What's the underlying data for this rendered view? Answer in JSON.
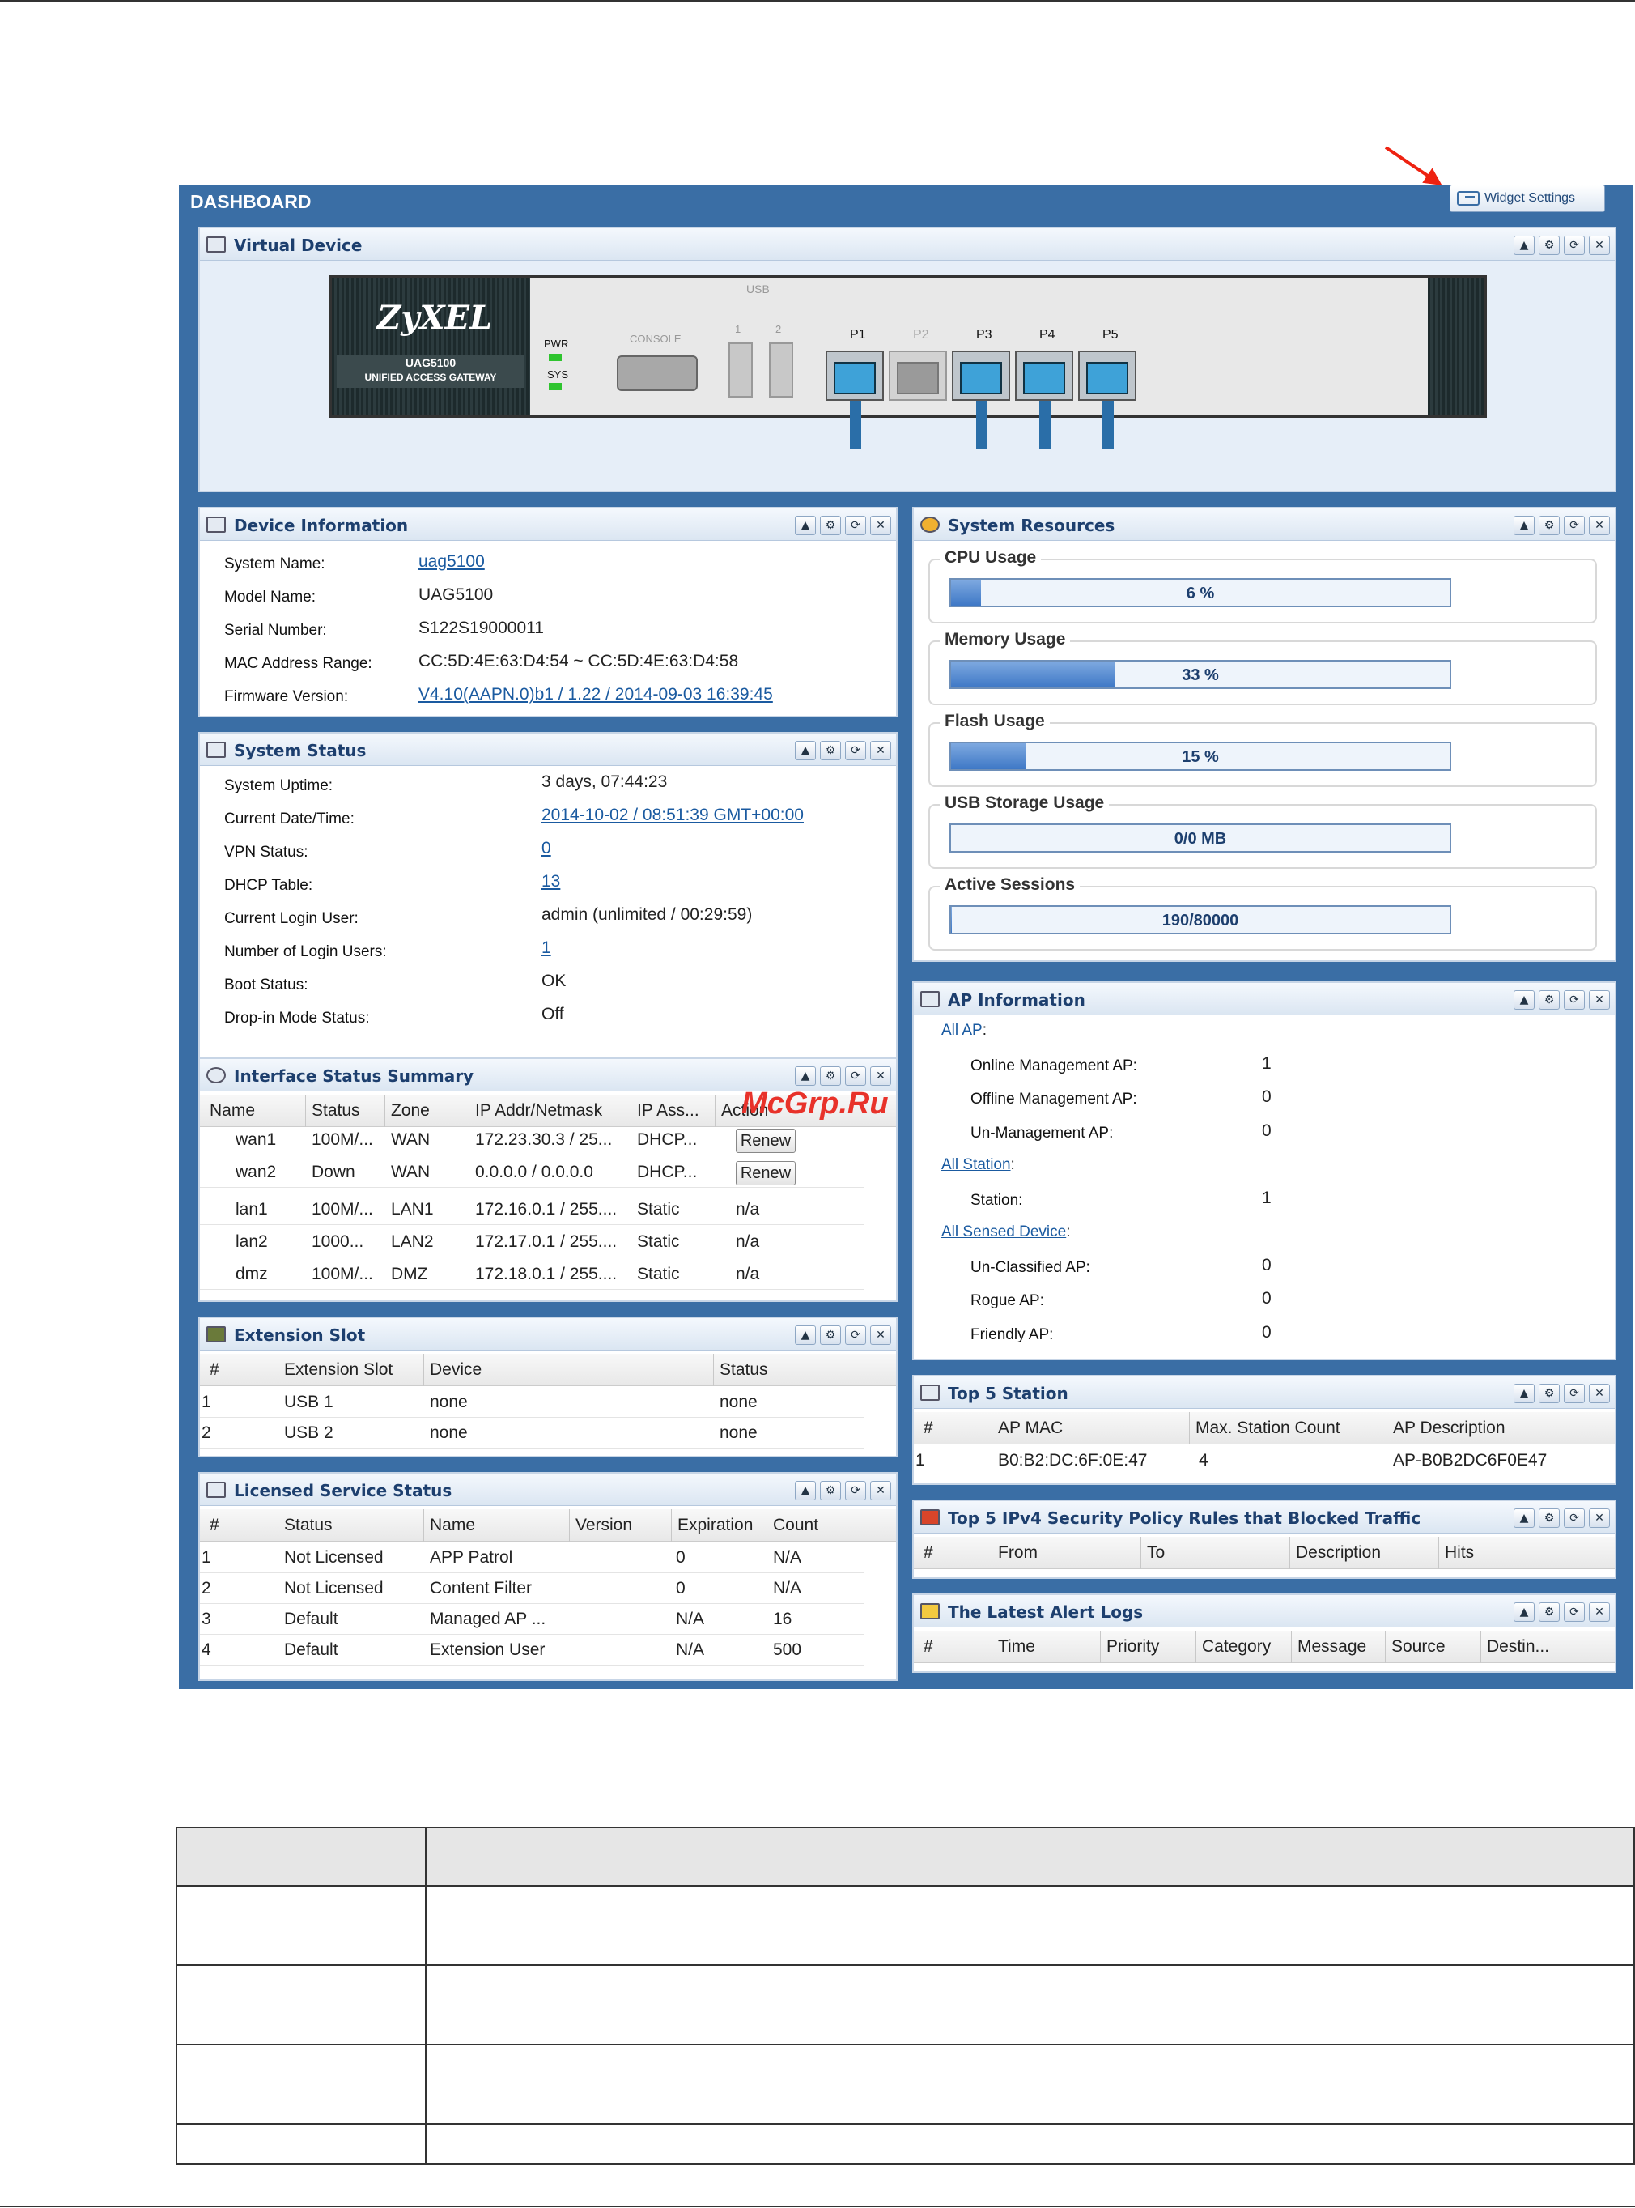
{
  "dashboard": {
    "title": "DASHBOARD",
    "widget_settings": "Widget Settings"
  },
  "virtual_device": {
    "title": "Virtual Device",
    "brand": "ZyXEL",
    "model": "UAG5100",
    "model_sub": "UNIFIED ACCESS GATEWAY",
    "leds": [
      "PWR",
      "SYS"
    ],
    "console": "CONSOLE",
    "usb": "USB",
    "usb_ports": [
      "1",
      "2"
    ],
    "ports": [
      "P1",
      "P2",
      "P3",
      "P4",
      "P5"
    ]
  },
  "device_info": {
    "title": "Device Information",
    "rows": [
      {
        "label": "System Name:",
        "value": "uag5100"
      },
      {
        "label": "Model Name:",
        "value": "UAG5100"
      },
      {
        "label": "Serial Number:",
        "value": "S122S19000011"
      },
      {
        "label": "MAC Address Range:",
        "value": "CC:5D:4E:63:D4:54 ~ CC:5D:4E:63:D4:58"
      },
      {
        "label": "Firmware Version:",
        "value": "V4.10(AAPN.0)b1 / 1.22 / 2014-09-03 16:39:45"
      }
    ]
  },
  "system_status": {
    "title": "System Status",
    "rows": [
      {
        "label": "System Uptime:",
        "value": "3 days, 07:44:23"
      },
      {
        "label": "Current Date/Time:",
        "value": "2014-10-02 / 08:51:39 GMT+00:00"
      },
      {
        "label": "VPN Status:",
        "value": "0"
      },
      {
        "label": "DHCP Table:",
        "value": "13"
      },
      {
        "label": "Current Login User:",
        "value": "admin (unlimited / 00:29:59)"
      },
      {
        "label": "Number of Login Users:",
        "value": "1"
      },
      {
        "label": "Boot Status:",
        "value": "OK"
      },
      {
        "label": "Drop-in Mode Status:",
        "value": "Off"
      }
    ]
  },
  "interface": {
    "title": "Interface Status Summary",
    "headers": [
      "Name",
      "Status",
      "Zone",
      "IP Addr/Netmask",
      "IP Ass...",
      "Action"
    ],
    "rows": [
      {
        "name": "wan1",
        "status": "100M/...",
        "zone": "WAN",
        "ip": "172.23.30.3 / 25...",
        "assign": "DHCP...",
        "action": "Renew"
      },
      {
        "name": "wan2",
        "status": "Down",
        "zone": "WAN",
        "ip": "0.0.0.0 / 0.0.0.0",
        "assign": "DHCP...",
        "action": "Renew"
      },
      {
        "name": "lan1",
        "status": "100M/...",
        "zone": "LAN1",
        "ip": "172.16.0.1 / 255....",
        "assign": "Static",
        "action": "n/a"
      },
      {
        "name": "lan2",
        "status": "1000...",
        "zone": "LAN2",
        "ip": "172.17.0.1 / 255....",
        "assign": "Static",
        "action": "n/a"
      },
      {
        "name": "dmz",
        "status": "100M/...",
        "zone": "DMZ",
        "ip": "172.18.0.1 / 255....",
        "assign": "Static",
        "action": "n/a"
      }
    ]
  },
  "extension_slot": {
    "title": "Extension Slot",
    "headers": [
      "#",
      "Extension Slot",
      "Device",
      "Status"
    ],
    "rows": [
      [
        "1",
        "USB 1",
        "none",
        "none"
      ],
      [
        "2",
        "USB 2",
        "none",
        "none"
      ]
    ]
  },
  "licensed": {
    "title": "Licensed Service Status",
    "headers": [
      "#",
      "Status",
      "Name",
      "Version",
      "Expiration",
      "Count"
    ],
    "rows": [
      [
        "1",
        "Not Licensed",
        "APP Patrol",
        "",
        "0",
        "N/A"
      ],
      [
        "2",
        "Not Licensed",
        "Content Filter",
        "",
        "0",
        "N/A"
      ],
      [
        "3",
        "Default",
        "Managed AP ...",
        "",
        "N/A",
        "16"
      ],
      [
        "4",
        "Default",
        "Extension User",
        "",
        "N/A",
        "500"
      ]
    ]
  },
  "resources": {
    "title": "System Resources",
    "items": [
      {
        "label": "CPU Usage",
        "text": "6 %",
        "percent": 6
      },
      {
        "label": "Memory Usage",
        "text": "33 %",
        "percent": 33
      },
      {
        "label": "Flash Usage",
        "text": "15 %",
        "percent": 15
      },
      {
        "label": "USB Storage Usage",
        "text": "0/0 MB",
        "percent": 0
      },
      {
        "label": "Active Sessions",
        "text": "190/80000",
        "percent": 0.2
      }
    ]
  },
  "ap_info": {
    "title": "AP Information",
    "all_ap": "All AP",
    "all_station": "All Station",
    "all_sensed": "All Sensed Device",
    "rows": [
      {
        "label": "Online Management AP:",
        "value": "1"
      },
      {
        "label": "Offline Management AP:",
        "value": "0"
      },
      {
        "label": "Un-Management AP:",
        "value": "0"
      },
      {
        "label": "Station:",
        "value": "1"
      },
      {
        "label": "Un-Classified AP:",
        "value": "0"
      },
      {
        "label": "Rogue AP:",
        "value": "0"
      },
      {
        "label": "Friendly AP:",
        "value": "0"
      }
    ]
  },
  "top_station": {
    "title": "Top 5 Station",
    "headers": [
      "#",
      "AP MAC",
      "Max. Station Count",
      "AP Description"
    ],
    "row": [
      "1",
      "B0:B2:DC:6F:0E:47",
      "4",
      "AP-B0B2DC6F0E47"
    ]
  },
  "top_rules": {
    "title": "Top 5 IPv4 Security Policy Rules that Blocked Traffic",
    "headers": [
      "#",
      "From",
      "To",
      "Description",
      "Hits"
    ]
  },
  "alerts": {
    "title": "The Latest Alert Logs",
    "headers": [
      "#",
      "Time",
      "Priority",
      "Category",
      "Message",
      "Source",
      "Destin..."
    ]
  },
  "watermark": "McGrp.Ru",
  "colors": {
    "header_blue": "#3a6ea5",
    "annotation_red": "#e21111",
    "bar_fill": "#3e78c6"
  }
}
